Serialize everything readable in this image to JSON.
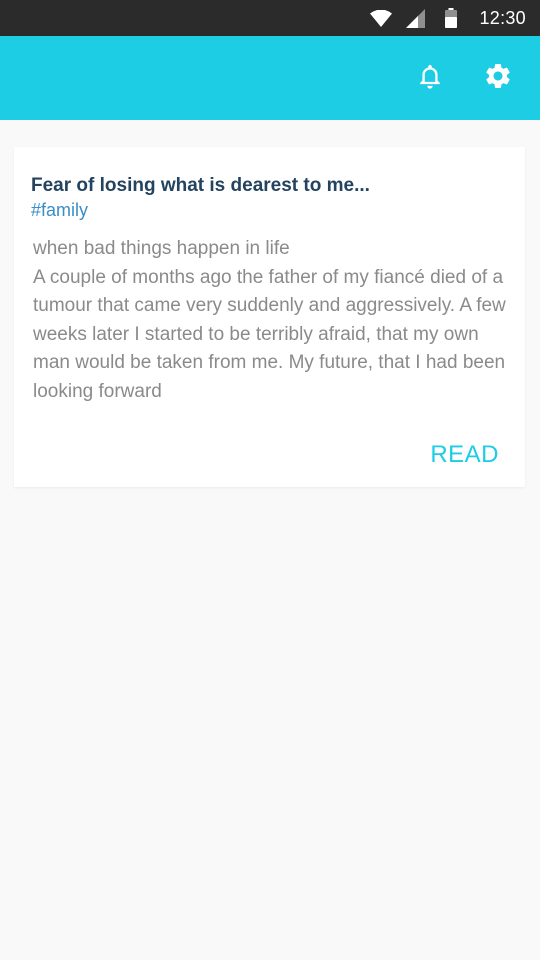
{
  "status_bar": {
    "time": "12:30",
    "icons": [
      "wifi-icon",
      "signal-icon",
      "battery-icon"
    ]
  },
  "app_bar": {
    "color": "#1ccde3",
    "actions": [
      "bell-icon",
      "gear-icon"
    ]
  },
  "post": {
    "title": "Fear of losing what is dearest to me...",
    "tag": "#family",
    "excerpt": "when bad things happen in life\n A couple of months ago the father of my fiancé died of a tumour that came very suddenly and aggres­sively. A few weeks later I started to be terribly afraid, that my own man would be taken from me. My future, that I had been looking forward",
    "read_label": "READ"
  }
}
